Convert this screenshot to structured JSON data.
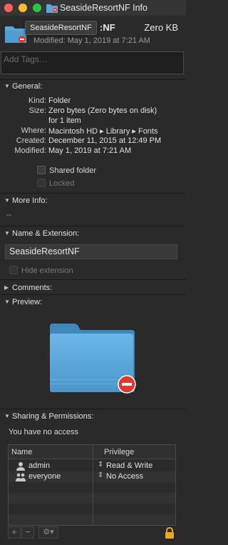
{
  "window": {
    "title": "SeasideResortNF Info",
    "tooltip": "SeasideResortNF",
    "name_tail": ":NF",
    "size": "Zero KB",
    "modified_line": "Modified: May 1, 2019 at 7:21 AM",
    "tags_placeholder": "Add Tags…"
  },
  "general": {
    "heading": "General:",
    "rows": [
      {
        "key": "Kind:",
        "value": "Folder"
      },
      {
        "key": "Size:",
        "value": "Zero bytes (Zero bytes on disk)"
      },
      {
        "key": "",
        "value": "for 1 item"
      },
      {
        "key": "Where:",
        "value": "Macintosh HD ▸ Library ▸ Fonts"
      },
      {
        "key": "Created:",
        "value": "December 11, 2015 at 12:49 PM"
      },
      {
        "key": "Modified:",
        "value": "May 1, 2019 at 7:21 AM"
      }
    ],
    "shared_folder": "Shared folder",
    "locked": "Locked"
  },
  "more_info": {
    "heading": "More Info:",
    "value": "--"
  },
  "name_ext": {
    "heading": "Name & Extension:",
    "value": "SeasideResortNF",
    "hide_extension": "Hide extension"
  },
  "comments": {
    "heading": "Comments:"
  },
  "preview": {
    "heading": "Preview:"
  },
  "sharing": {
    "heading": "Sharing & Permissions:",
    "status": "You have no access",
    "col_name": "Name",
    "col_privilege": "Privilege",
    "rows": [
      {
        "name": "admin",
        "privilege": "Read & Write",
        "icon": "user-icon"
      },
      {
        "name": "everyone",
        "privilege": "No Access",
        "icon": "group-icon"
      }
    ],
    "add": "+",
    "remove": "−",
    "action": "⚙▾"
  },
  "colors": {
    "folder": "#5aa9dc",
    "badge": "#e0382b",
    "background": "#2a2a2a"
  }
}
